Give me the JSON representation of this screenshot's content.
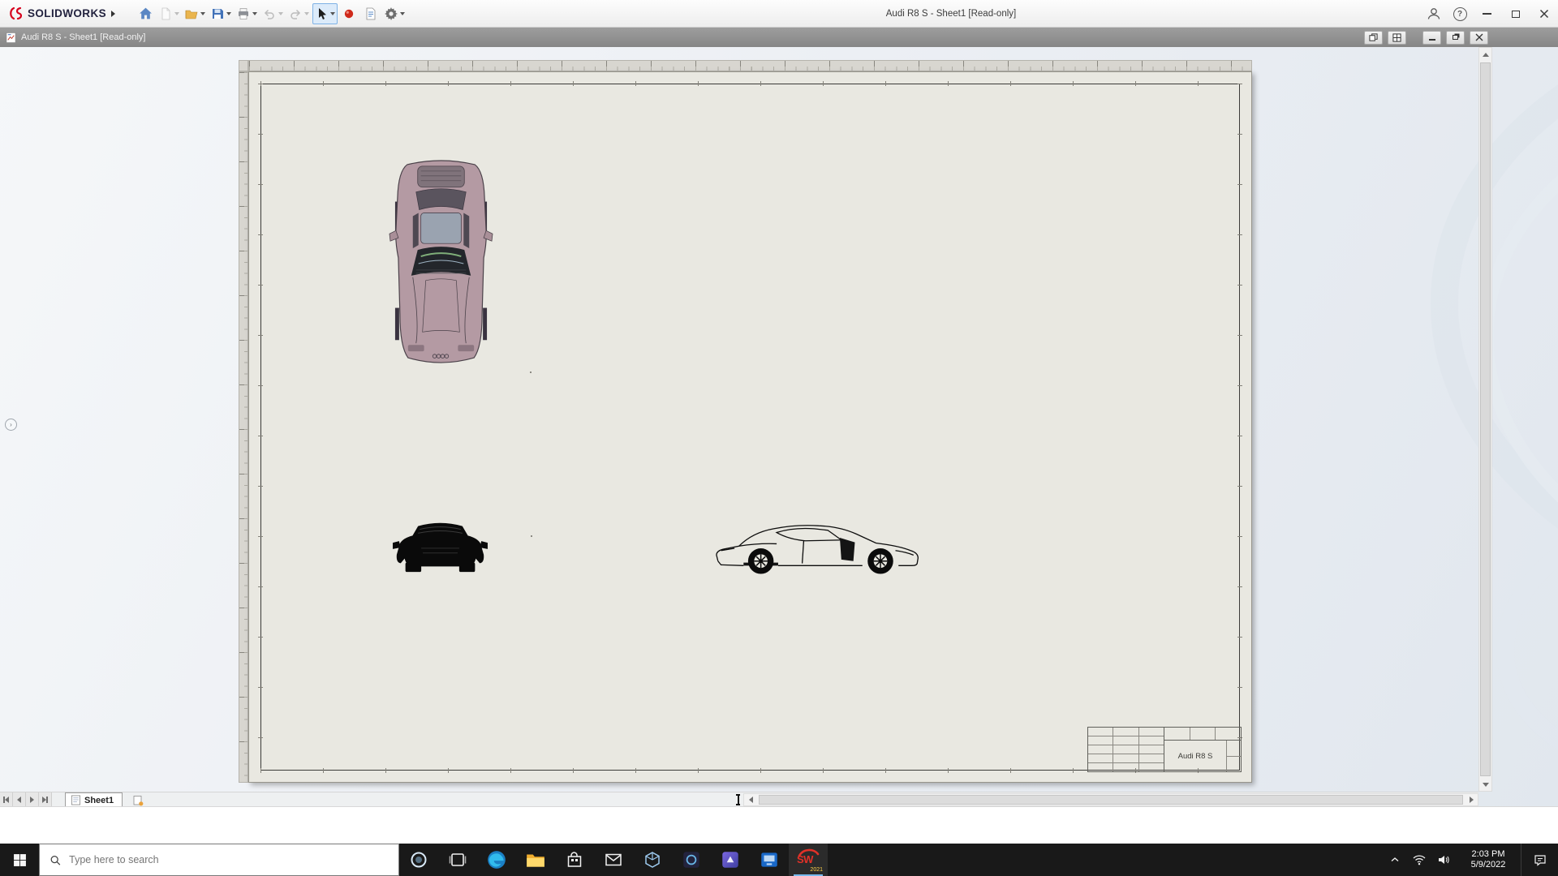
{
  "app": {
    "brand": "SOLIDWORKS",
    "title": "Audi R8 S - Sheet1 [Read-only]"
  },
  "titlebar": {
    "help_glyph": "?",
    "tools": [
      "home",
      "new",
      "open",
      "save",
      "print",
      "undo",
      "redo",
      "select",
      "rebuild",
      "file-properties",
      "options"
    ],
    "window_controls": [
      "account",
      "help",
      "minimize",
      "maximize",
      "close"
    ]
  },
  "document_window": {
    "title": "Audi R8 S - Sheet1 [Read-only]",
    "controls": [
      "cascade-icon",
      "tile-icon",
      "minimize",
      "restore",
      "close"
    ]
  },
  "drawing": {
    "sheet_color": "#e9e8e1",
    "views": [
      "top-view",
      "front-view",
      "side-view"
    ],
    "title_block": {
      "part_name": "Audi R8 S"
    }
  },
  "sheet_tabs": {
    "active_tab": "Sheet1"
  },
  "taskbar": {
    "search_placeholder": "Type here to search",
    "time": "2:03 PM",
    "date": "5/9/2022",
    "solidworks_badge": "SW",
    "solidworks_year": "2021",
    "pinned": [
      "start",
      "search",
      "cortana",
      "task-view",
      "edge",
      "file-explorer",
      "store",
      "mail",
      "3d-viewer",
      "dark-app",
      "purple-app",
      "blue-app",
      "solidworks-2021"
    ],
    "tray": [
      "hidden-icons-chevron",
      "network",
      "volume",
      "clock",
      "notifications"
    ]
  },
  "colors": {
    "taskbar_bg": "#191919",
    "active_app_underline": "#76b9ed",
    "solidworks_red": "#d6001c",
    "sheet": "#e9e8e1"
  }
}
